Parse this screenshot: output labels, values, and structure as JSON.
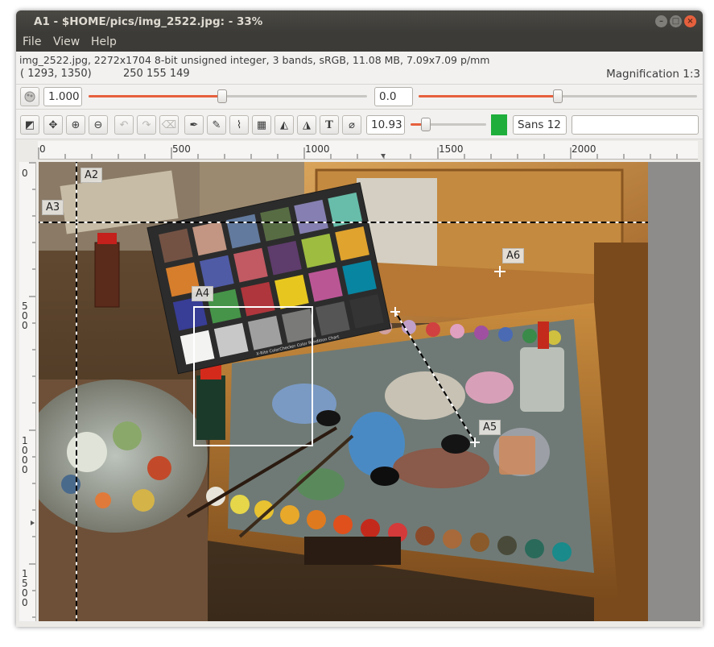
{
  "window": {
    "title": "A1 - $HOME/pics/img_2522.jpg: - 33%",
    "btn_min": "–",
    "btn_max": "□",
    "btn_close": "×"
  },
  "menu": [
    "File",
    "View",
    "Help"
  ],
  "info": {
    "header": "img_2522.jpg, 2272x1704 8-bit unsigned integer, 3 bands, sRGB, 11.08 MB, 7.09x7.09 p/mm",
    "coords": "( 1293,  1350)",
    "pixel": "250 155 149",
    "magnification": "Magnification 1:3"
  },
  "row1": {
    "scale_value": "1.000",
    "offset_value": "0.0",
    "scale_level": 0.48,
    "offset_level": 0.5
  },
  "row2": {
    "line_width": "10.93",
    "width_level": 0.2,
    "font_name": "Sans 12",
    "text_field": "",
    "ink_color": "#1fae3b"
  },
  "ruler": {
    "top_labels": [
      "0",
      "500",
      "1000",
      "1500",
      "2000"
    ],
    "left_labels": [
      "0",
      "500",
      "1000",
      "1500"
    ]
  },
  "annotations": [
    "A2",
    "A3",
    "A4",
    "A5",
    "A6"
  ],
  "chart_checker_text": "X-Rite ColorChecker Color Rendition Chart"
}
